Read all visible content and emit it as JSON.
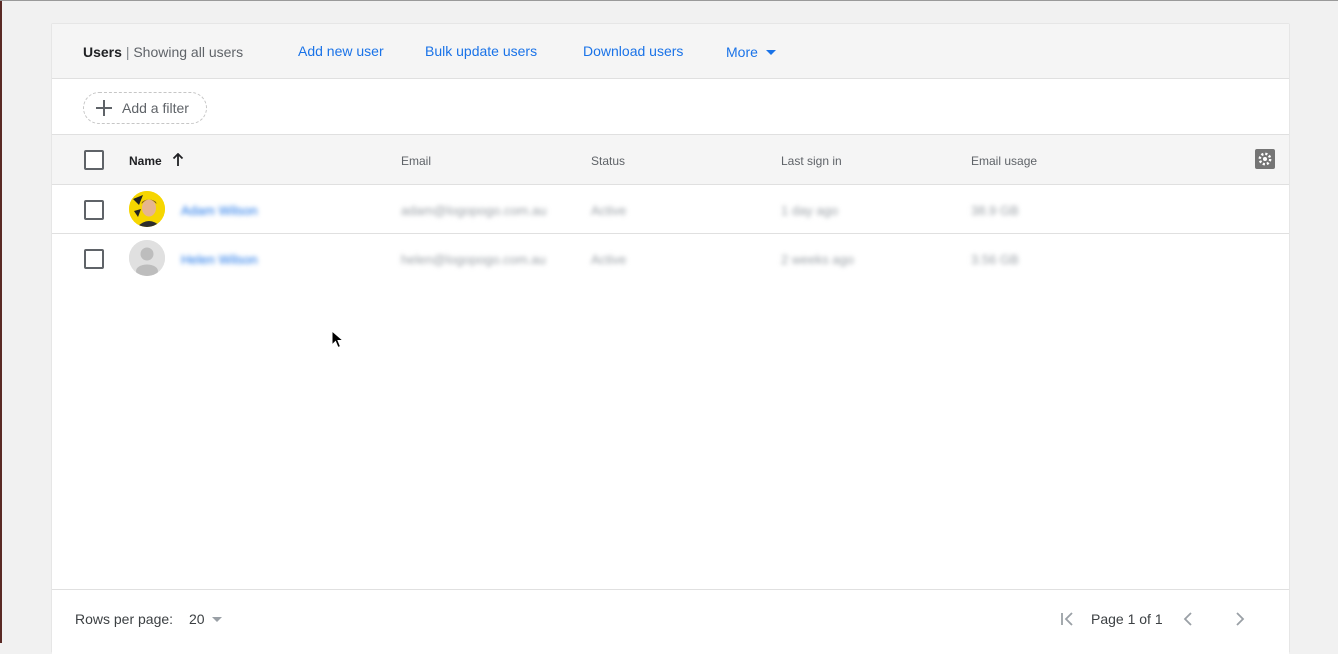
{
  "header": {
    "title": "Users",
    "separator": "|",
    "subtitle": "Showing all users",
    "actions": {
      "add_new_user": "Add new user",
      "bulk_update": "Bulk update users",
      "download": "Download users",
      "more": "More"
    }
  },
  "filter": {
    "add_filter_label": "Add a filter"
  },
  "table": {
    "columns": {
      "name": "Name",
      "email": "Email",
      "status": "Status",
      "last_sign_in": "Last sign in",
      "email_usage": "Email usage"
    },
    "rows": [
      {
        "name": "Adam Wilson",
        "email": "adam@logopogo.com.au",
        "status": "Active",
        "last_sign_in": "1 day ago",
        "email_usage": "38.9 GB",
        "avatar": "photo"
      },
      {
        "name": "Helen Wilson",
        "email": "helen@logopogo.com.au",
        "status": "Active",
        "last_sign_in": "2 weeks ago",
        "email_usage": "3.56 GB",
        "avatar": "default-person-icon"
      }
    ]
  },
  "footer": {
    "rows_per_page_label": "Rows per page:",
    "rows_per_page_value": "20",
    "page_info": "Page 1 of 1"
  },
  "colors": {
    "link": "#1a73e8",
    "header_bg": "#f5f5f5",
    "avatar_accent": "#f6d600"
  }
}
